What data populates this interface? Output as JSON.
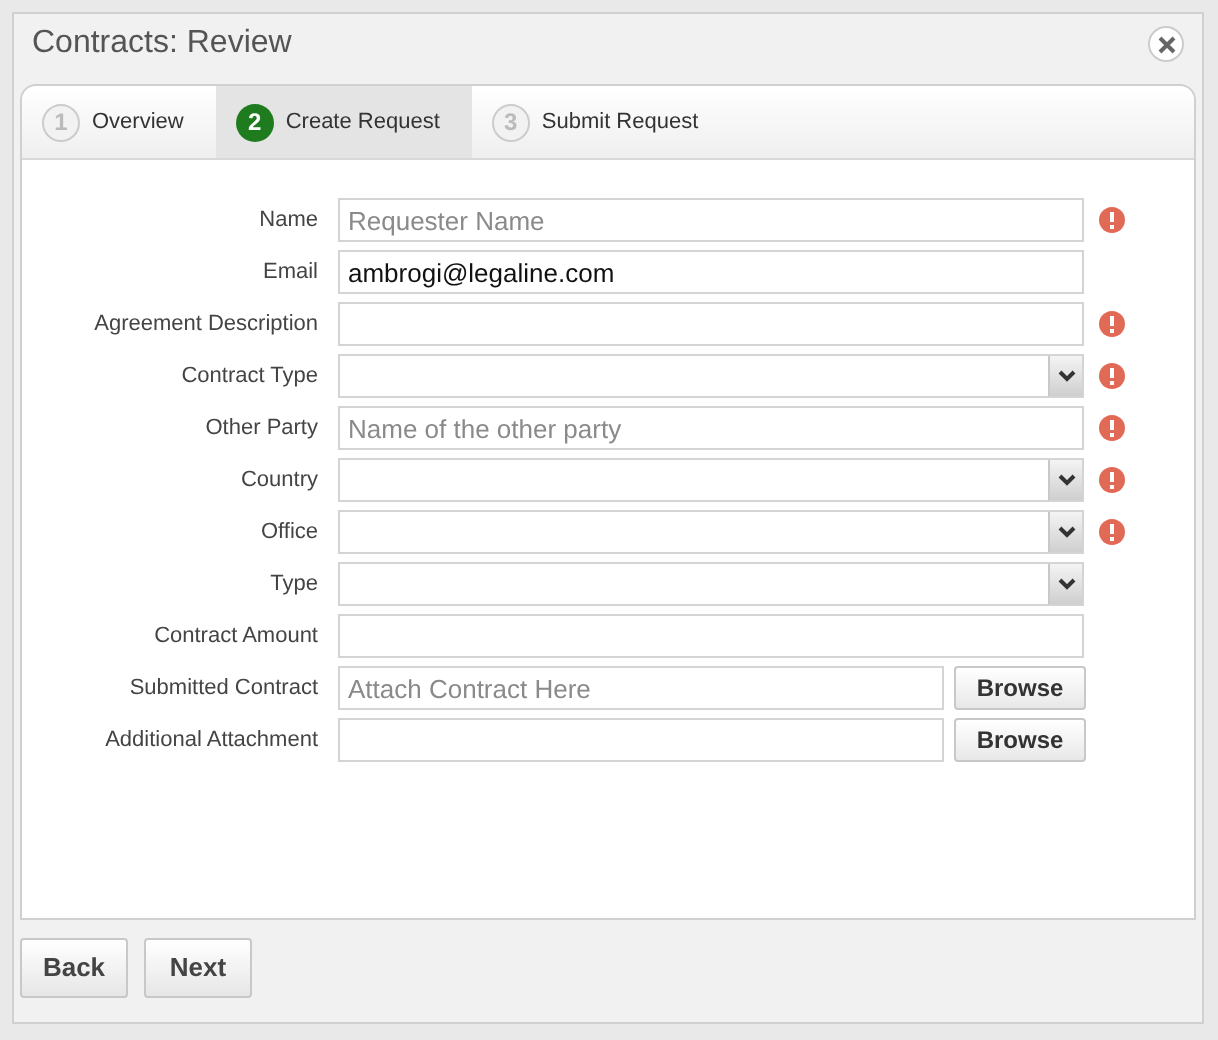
{
  "window": {
    "title": "Contracts: Review"
  },
  "steps": [
    {
      "number": "1",
      "label": "Overview",
      "selected": false
    },
    {
      "number": "2",
      "label": "Create Request",
      "selected": true
    },
    {
      "number": "3",
      "label": "Submit Request",
      "selected": false
    }
  ],
  "fields": [
    {
      "kind": "text",
      "label": "Name",
      "placeholder": "Requester Name",
      "required": true
    },
    {
      "kind": "text",
      "label": "Email",
      "value": "ambrogi@legaline.com",
      "required": false
    },
    {
      "kind": "text",
      "label": "Agreement Description",
      "required": true
    },
    {
      "kind": "select",
      "label": "Contract Type",
      "required": true
    },
    {
      "kind": "text",
      "label": "Other Party",
      "placeholder": "Name of the other party",
      "required": true
    },
    {
      "kind": "select",
      "label": "Country",
      "required": true
    },
    {
      "kind": "select",
      "label": "Office",
      "required": true
    },
    {
      "kind": "select",
      "label": "Type",
      "required": false
    },
    {
      "kind": "text",
      "label": "Contract Amount",
      "required": false
    },
    {
      "kind": "file",
      "label": "Submitted Contract",
      "placeholder": "Attach Contract Here",
      "button": "Browse",
      "required": false
    },
    {
      "kind": "file",
      "label": "Additional Attachment",
      "button": "Browse",
      "required": false
    }
  ],
  "buttons": [
    "Back",
    "Next"
  ]
}
